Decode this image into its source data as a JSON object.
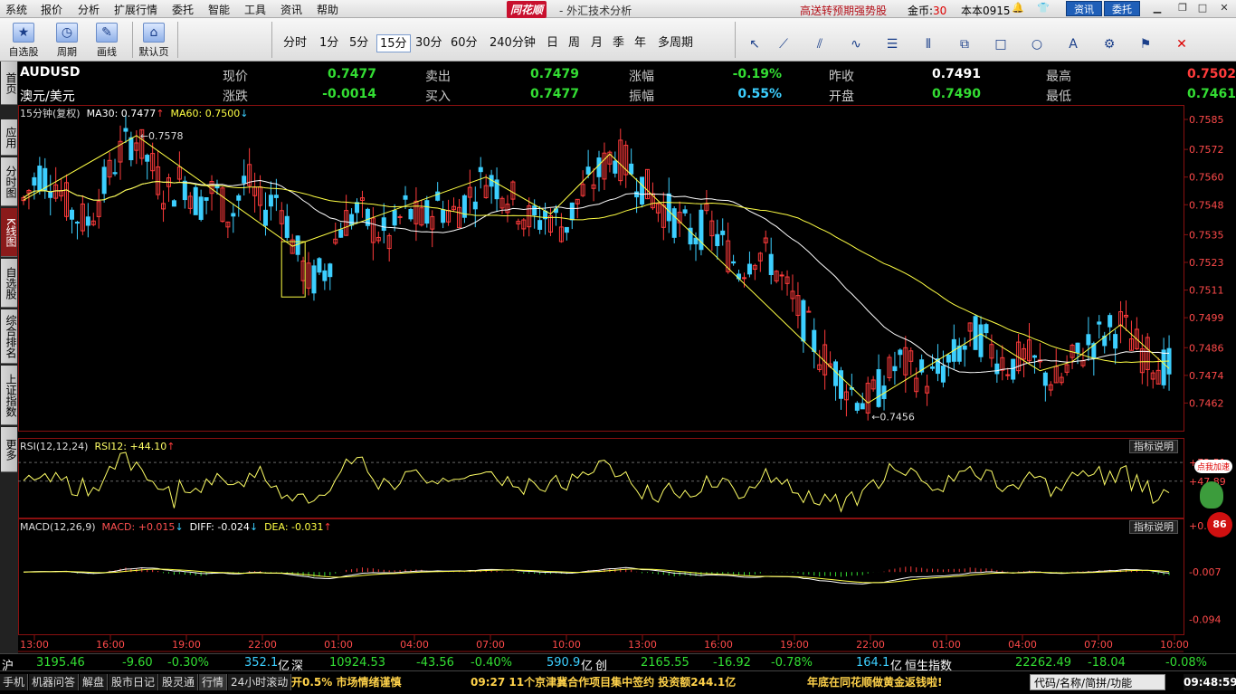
{
  "menu": [
    "系统",
    "报价",
    "分析",
    "扩展行情",
    "委托",
    "智能",
    "工具",
    "资讯",
    "帮助"
  ],
  "brand": {
    "logo": "同花顺",
    "sub": "- 外汇技术分析"
  },
  "promo": "高送转预期强势股",
  "gold": {
    "label": "金币:",
    "value": "30"
  },
  "version": "本本0915",
  "top_buttons": {
    "news": "资讯",
    "trade": "委托"
  },
  "toolbar": {
    "buttons": [
      {
        "label": "自选股",
        "icon": "★"
      },
      {
        "label": "周期",
        "icon": "◷"
      },
      {
        "label": "画线",
        "icon": "✎"
      },
      {
        "label": "默认页",
        "icon": "⌂"
      }
    ],
    "periods": [
      "分时",
      "1分",
      "5分",
      "15分",
      "30分",
      "60分",
      "240分钟",
      "日",
      "周",
      "月",
      "季",
      "年",
      "多周期"
    ],
    "active_period": "15分",
    "tools": [
      "↖",
      "⟋",
      "⫽",
      "∿",
      "☰",
      "⦀",
      "⧉",
      "□",
      "○",
      "A",
      "⚙",
      "⚑",
      "✕"
    ]
  },
  "side_tabs": [
    "首页",
    "应用",
    "分时图",
    "K线图",
    "自选股",
    "综合排名",
    "上证指数",
    "更多"
  ],
  "quote": {
    "symbol": "AUDUSD",
    "name": "澳元/美元",
    "row1": [
      {
        "label": "现价",
        "value": "0.7477",
        "cls": "down"
      },
      {
        "label": "卖出",
        "value": "0.7479",
        "cls": "down"
      },
      {
        "label": "涨幅",
        "value": "-0.19%",
        "cls": "down"
      },
      {
        "label": "昨收",
        "value": "0.7491",
        "cls": "white"
      },
      {
        "label": "最高",
        "value": "0.7502",
        "cls": "up"
      }
    ],
    "row2": [
      {
        "label": "涨跌",
        "value": "-0.0014",
        "cls": "down"
      },
      {
        "label": "买入",
        "value": "0.7477",
        "cls": "down"
      },
      {
        "label": "振幅",
        "value": "0.55%",
        "cls": "cyan"
      },
      {
        "label": "开盘",
        "value": "0.7490",
        "cls": "down"
      },
      {
        "label": "最低",
        "value": "0.7461",
        "cls": "down"
      }
    ]
  },
  "main_legend": {
    "period": "15分钟(复权)",
    "ma30": "MA30: 0.7477",
    "ma30_arrow": "↑",
    "ma60": "MA60: 0.7500",
    "ma60_arrow": "↓"
  },
  "rsi_legend": {
    "name": "RSI(12,12,24)",
    "value": "RSI12: +44.10",
    "arrow": "↑"
  },
  "macd_legend": {
    "name": "MACD(12,26,9)",
    "macd": "MACD: +0.015",
    "macd_arrow": "↓",
    "diff": "DIFF: -0.024",
    "diff_arrow": "↓",
    "dea": "DEA: -0.031",
    "dea_arrow": "↑"
  },
  "help_label": "指标说明",
  "badge": {
    "label": "点我加速",
    "count": "86"
  },
  "colors": {
    "up": "#ff3b3b",
    "down": "#3ccfff",
    "ma30": "#ffffff",
    "ma60": "#ffff44",
    "zigzag": "#ffff44",
    "grid": "#8a1010"
  },
  "chart_data": {
    "type": "candlestick",
    "price_axis": [
      "0.7585",
      "0.7572",
      "0.7560",
      "0.7548",
      "0.7535",
      "0.7523",
      "0.7511",
      "0.7499",
      "0.7486",
      "0.7474",
      "0.7462"
    ],
    "ylim": [
      0.745,
      0.7585
    ],
    "time_axis": [
      "13:00",
      "16:00",
      "19:00",
      "22:00",
      "01:00",
      "04:00",
      "07:00",
      "10:00",
      "13:00",
      "16:00",
      "19:00",
      "22:00",
      "01:00",
      "04:00",
      "07:00",
      "10:00"
    ],
    "annotations": [
      {
        "text": "0.7578",
        "type": "high"
      },
      {
        "text": "0.7456",
        "type": "low"
      }
    ],
    "price_path": [
      0.755,
      0.7562,
      0.7558,
      0.7545,
      0.754,
      0.7555,
      0.757,
      0.7578,
      0.7565,
      0.7552,
      0.756,
      0.7548,
      0.7555,
      0.7542,
      0.756,
      0.7545,
      0.7553,
      0.753,
      0.7514,
      0.752,
      0.754,
      0.7545,
      0.7538,
      0.7533,
      0.7546,
      0.754,
      0.7548,
      0.7544,
      0.7552,
      0.756,
      0.7556,
      0.7548,
      0.754,
      0.7544,
      0.7538,
      0.7552,
      0.756,
      0.757,
      0.7565,
      0.7556,
      0.7548,
      0.7542,
      0.7534,
      0.754,
      0.753,
      0.752,
      0.7528,
      0.7524,
      0.751,
      0.7498,
      0.7484,
      0.7476,
      0.7468,
      0.7462,
      0.747,
      0.748,
      0.7476,
      0.7472,
      0.7478,
      0.7486,
      0.7492,
      0.7484,
      0.7478,
      0.7482,
      0.7476,
      0.747,
      0.748,
      0.7488,
      0.7492,
      0.7496,
      0.7486,
      0.748,
      0.7477
    ],
    "rsi_axis": [
      "+72.51",
      "+47.89"
    ],
    "macd_axis": [
      "+0.078",
      "-0.007",
      "-0.094"
    ]
  },
  "ticker": {
    "sh": {
      "name": "沪",
      "price": "3195.46",
      "chg": "-9.60",
      "pct": "-0.30%",
      "vol": "352.1",
      "unit": "亿"
    },
    "sz": {
      "name": "深",
      "price": "10924.53",
      "chg": "-43.56",
      "pct": "-0.40%",
      "vol": "590.9",
      "unit": "亿"
    },
    "cy": {
      "name": "创",
      "price": "2165.55",
      "chg": "-16.92",
      "pct": "-0.78%",
      "vol": "164.1",
      "unit": "亿"
    },
    "hs": {
      "name": "恒生指数",
      "price": "22262.49",
      "chg": "-18.04",
      "pct": "-0.08%"
    }
  },
  "status": {
    "tabs": [
      "手机",
      "机器问答",
      "解盘",
      "股市日记",
      "股灵通",
      "行情",
      "24小时滚动"
    ],
    "news1": "开0.5% 市场情绪谨慎",
    "news2": "09:27 11个京津冀合作项目集中签约 投资额244.1亿",
    "news3": "年底在同花顺做黄金返钱啦!",
    "search_placeholder": "代码/名称/简拼/功能",
    "clock": "09:48:59"
  }
}
